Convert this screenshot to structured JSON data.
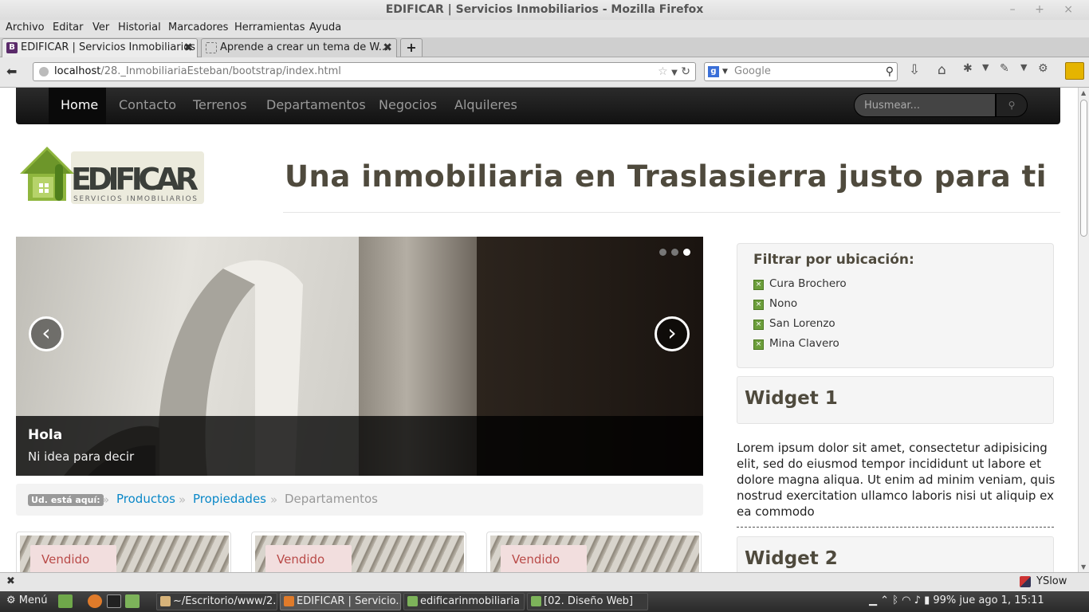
{
  "window": {
    "title": "EDIFICAR | Servicios Inmobiliarios - Mozilla Firefox",
    "controls": "– + ×"
  },
  "menubar": [
    "Archivo",
    "Editar",
    "Ver",
    "Historial",
    "Marcadores",
    "Herramientas",
    "Ayuda"
  ],
  "tabs": [
    {
      "label": "EDIFICAR | Servicios Inmobiliarios",
      "icon": "B"
    },
    {
      "label": "Aprende a crear un tema de W...",
      "icon": ""
    }
  ],
  "newtab": "+",
  "url": {
    "host": "localhost",
    "path": "/28._InmobiliariaEsteban/bootstrap/index.html"
  },
  "search": {
    "engine_icon": "g",
    "placeholder": "Google"
  },
  "site": {
    "nav": [
      "Home",
      "Contacto",
      "Terrenos",
      "Departamentos",
      "Negocios",
      "Alquileres"
    ],
    "search_placeholder": "Husmear...",
    "logo_text": "EDIFICAR",
    "logo_subtext": "SERVICIOS INMOBILIARIOS",
    "headline": "Una inmobiliaria en Traslasierra justo para ti",
    "carousel": {
      "title": "Hola",
      "subtitle": "Ni idea para decir",
      "prev": "‹",
      "next": "›",
      "active_index": 2,
      "count": 3
    },
    "breadcrumb": {
      "label": "Ud. está aquí:",
      "items": [
        "Productos",
        "Propiedades",
        "Departamentos"
      ],
      "sep": "»"
    },
    "cards": [
      "Vendido",
      "Vendido",
      "Vendido"
    ],
    "filter": {
      "title": "Filtrar por ubicación:",
      "items": [
        "Cura Brochero",
        "Nono",
        "San Lorenzo",
        "Mina Clavero"
      ]
    },
    "widget1": {
      "title": "Widget 1",
      "text": "Lorem ipsum dolor sit amet, consectetur adipisicing elit, sed do eiusmod tempor incididunt ut labore et dolore magna aliqua. Ut enim ad minim veniam, quis nostrud exercitation ullamco laboris nisi ut aliquip ex ea commodo"
    },
    "widget2": {
      "title": "Widget 2"
    }
  },
  "addonbar": {
    "close": "✖",
    "yslow": "YSlow"
  },
  "taskbar": {
    "menu": "Menú",
    "tasks": [
      "~/Escritorio/www/2...",
      "EDIFICAR | Servicio...",
      "edificarinmobiliaria",
      "[02. Diseño Web]"
    ],
    "tray": "99% jue ago  1, 15:11"
  },
  "colors": {
    "headline": "#4f4a3d",
    "link": "#0a88c8",
    "badge_bg": "#f2dede",
    "badge_text": "#b94a48",
    "nav_bg": "#1b1b1b"
  }
}
